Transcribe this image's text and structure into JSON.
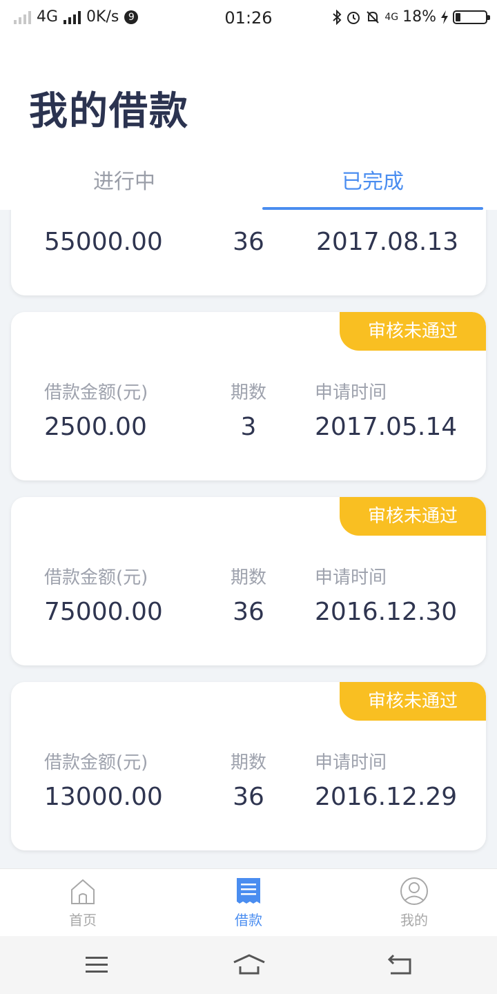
{
  "status_bar": {
    "network": "4G",
    "speed": "0K/s",
    "notif_count": "9",
    "time": "01:26",
    "network2": "4G",
    "battery": "18%"
  },
  "header": {
    "title": "我的借款"
  },
  "tabs": [
    {
      "label": "进行中",
      "active": false
    },
    {
      "label": "已完成",
      "active": true
    }
  ],
  "cards": [
    {
      "amount": "55000.00",
      "periods": "36",
      "date": "2017.08.13"
    },
    {
      "status": "审核未通过",
      "amount_label": "借款金额(元)",
      "periods_label": "期数",
      "date_label": "申请时间",
      "amount": "2500.00",
      "periods": "3",
      "date": "2017.05.14"
    },
    {
      "status": "审核未通过",
      "amount_label": "借款金额(元)",
      "periods_label": "期数",
      "date_label": "申请时间",
      "amount": "75000.00",
      "periods": "36",
      "date": "2016.12.30"
    },
    {
      "status": "审核未通过",
      "amount_label": "借款金额(元)",
      "periods_label": "期数",
      "date_label": "申请时间",
      "amount": "13000.00",
      "periods": "36",
      "date": "2016.12.29"
    }
  ],
  "bottom_nav": [
    {
      "label": "首页",
      "icon": "home-icon",
      "active": false
    },
    {
      "label": "借款",
      "icon": "document-icon",
      "active": true
    },
    {
      "label": "我的",
      "icon": "user-icon",
      "active": false
    }
  ],
  "colors": {
    "accent": "#4a8df0",
    "badge": "#f9bf22",
    "text_dark": "#2f3550",
    "text_muted": "#9ea2ad",
    "list_bg": "#f1f4f7"
  }
}
